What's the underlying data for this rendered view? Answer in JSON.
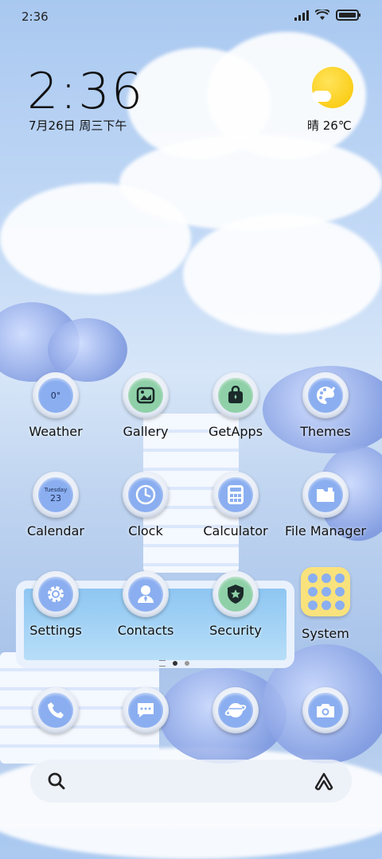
{
  "status_bar": {
    "time": "2:36"
  },
  "clock_widget": {
    "time": "2:36",
    "date": "7月26日 周三下午"
  },
  "weather_widget": {
    "text": "晴 26℃"
  },
  "apps_row1": [
    {
      "label": "Weather",
      "icon": "weather-icon",
      "inner": "0°"
    },
    {
      "label": "Gallery",
      "icon": "gallery-icon"
    },
    {
      "label": "GetApps",
      "icon": "getapps-icon"
    },
    {
      "label": "Themes",
      "icon": "themes-icon"
    }
  ],
  "apps_row2": [
    {
      "label": "Calendar",
      "icon": "calendar-icon",
      "day": "Tuesday",
      "date": "23"
    },
    {
      "label": "Clock",
      "icon": "clock-icon"
    },
    {
      "label": "Calculator",
      "icon": "calculator-icon"
    },
    {
      "label": "File Manager",
      "icon": "file-manager-icon"
    }
  ],
  "apps_row3": [
    {
      "label": "Settings",
      "icon": "gear-icon"
    },
    {
      "label": "Contacts",
      "icon": "contacts-icon"
    },
    {
      "label": "Security",
      "icon": "shield-star-icon"
    },
    {
      "label": "System",
      "icon": "folder-icon"
    }
  ],
  "dock": [
    {
      "icon": "phone-icon"
    },
    {
      "icon": "message-icon"
    },
    {
      "icon": "browser-icon"
    },
    {
      "icon": "camera-icon"
    }
  ],
  "page_indicator": {
    "pages": 2,
    "current": 1
  },
  "colors": {
    "icon_blue": "#8aaef0",
    "icon_green": "#8fd0a8",
    "folder_yellow": "#f9e27c",
    "sun": "#f9c600"
  }
}
